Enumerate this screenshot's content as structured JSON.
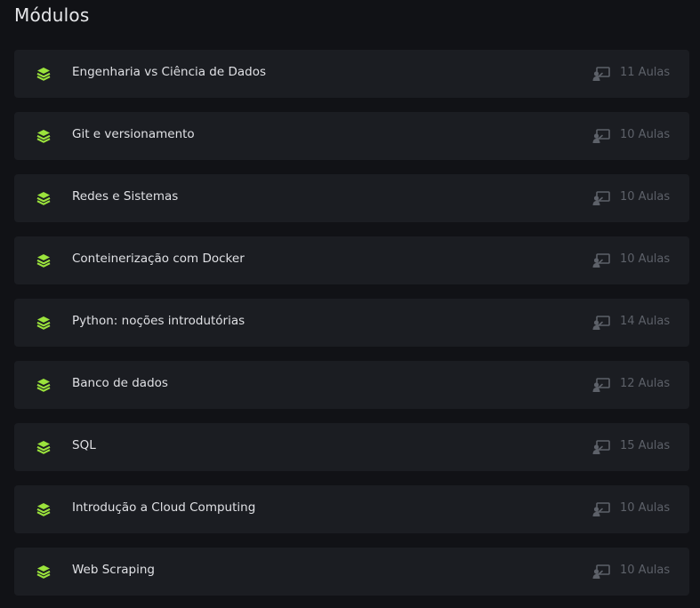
{
  "page": {
    "section_title": "Módulos"
  },
  "colors": {
    "accent": "#9be33c",
    "card_bg": "#1b1d22",
    "page_bg": "#111216",
    "muted": "#5d6169"
  },
  "icons": {
    "module_icon": "layers-icon",
    "lesson_icon": "presentation-screen-icon"
  },
  "modules": [
    {
      "name": "Engenharia vs Ciência de Dados",
      "lessons": "11 Aulas"
    },
    {
      "name": "Git e versionamento",
      "lessons": "10 Aulas"
    },
    {
      "name": "Redes e Sistemas",
      "lessons": "10 Aulas"
    },
    {
      "name": "Conteinerização com Docker",
      "lessons": "10 Aulas"
    },
    {
      "name": "Python: noções introdutórias",
      "lessons": "14 Aulas"
    },
    {
      "name": "Banco de dados",
      "lessons": "12 Aulas"
    },
    {
      "name": "SQL",
      "lessons": "15 Aulas"
    },
    {
      "name": "Introdução a Cloud Computing",
      "lessons": "10 Aulas"
    },
    {
      "name": "Web Scraping",
      "lessons": "10 Aulas"
    }
  ]
}
